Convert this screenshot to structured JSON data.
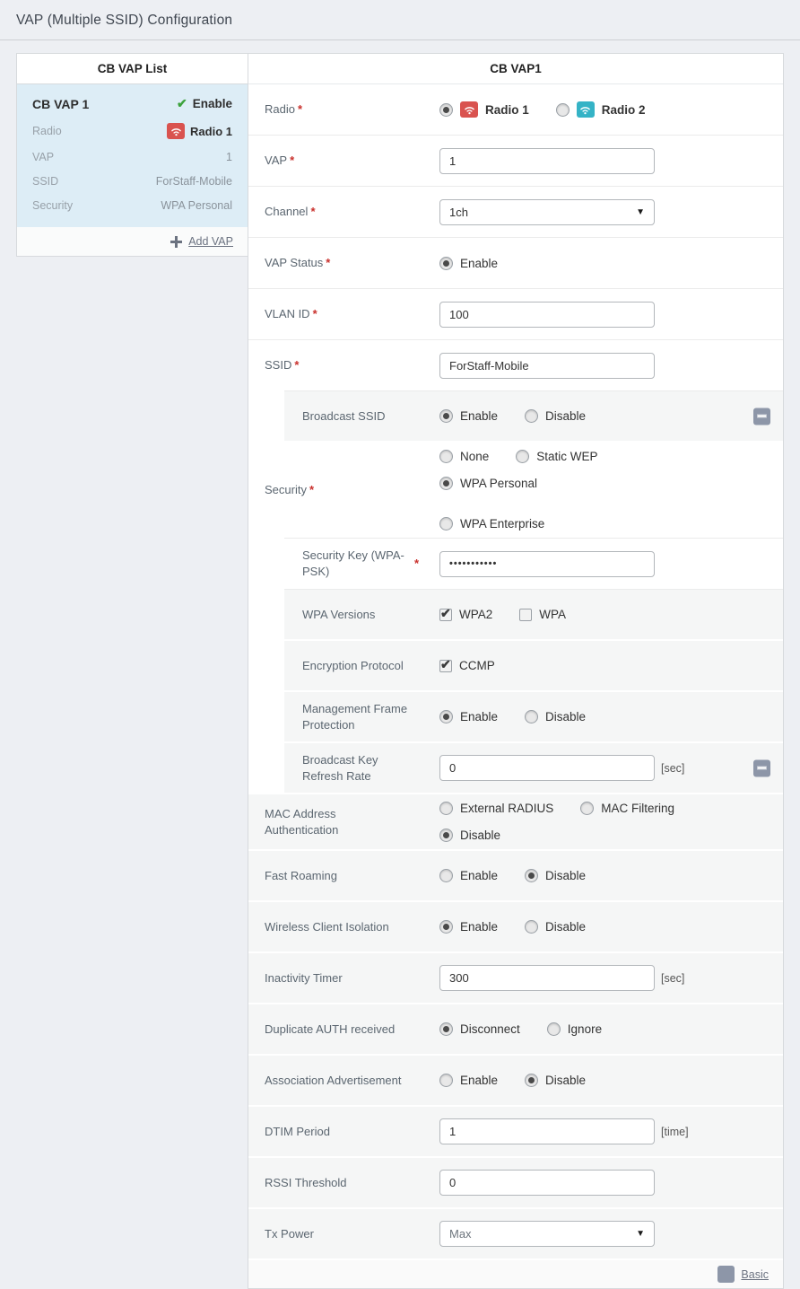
{
  "page": {
    "title": "VAP (Multiple SSID) Configuration"
  },
  "icons": {
    "check": "✔",
    "plus": "➕",
    "caret_down": "▼"
  },
  "colors": {
    "radio1_badge": "#d9534f",
    "radio2_badge": "#35b3c6",
    "enable_check": "#3ca23c",
    "selected_item_bg": "#ddedf6",
    "required_asterisk": "#c9302c",
    "collapse_icon_bg": "#8d96a8"
  },
  "required_marker": "*",
  "vap_list": {
    "header": "CB VAP List",
    "selected_item": {
      "name": "CB VAP 1",
      "status": "Enable",
      "fields": [
        {
          "label": "Radio",
          "value": "Radio 1",
          "badge": "radio1_badge"
        },
        {
          "label": "VAP",
          "value": "1"
        },
        {
          "label": "SSID",
          "value": "ForStaff-Mobile"
        },
        {
          "label": "Security",
          "value": "WPA Personal"
        }
      ]
    },
    "add_link": "Add VAP"
  },
  "form": {
    "header": "CB VAP1",
    "footer": {
      "link": "Basic"
    },
    "rows": [
      {
        "label": "Radio",
        "required": true,
        "control": {
          "type": "radio",
          "options": [
            {
              "label": "Radio 1",
              "selected": true,
              "badge": "radio1_badge",
              "bold": true
            },
            {
              "label": "Radio 2",
              "badge": "radio2_badge",
              "bold": true
            }
          ]
        }
      },
      {
        "label": "VAP",
        "required": true,
        "control": {
          "type": "text",
          "value": "1"
        }
      },
      {
        "label": "Channel",
        "required": true,
        "control": {
          "type": "select",
          "value": "1ch"
        }
      },
      {
        "label": "VAP Status",
        "required": true,
        "control": {
          "type": "radio",
          "options": [
            {
              "label": "Enable",
              "selected": true
            }
          ]
        }
      },
      {
        "label": "VLAN ID",
        "required": true,
        "control": {
          "type": "text",
          "value": "100"
        }
      },
      {
        "label": "SSID",
        "required": true,
        "control": {
          "type": "text",
          "value": "ForStaff-Mobile"
        }
      },
      {
        "label": "Broadcast SSID",
        "indent": true,
        "gray": true,
        "collapse": true,
        "control": {
          "type": "radio",
          "options": [
            {
              "label": "Enable",
              "selected": true
            },
            {
              "label": "Disable"
            }
          ]
        }
      },
      {
        "label": "Security",
        "required": true,
        "tall": true,
        "control": {
          "type": "radio",
          "options": [
            {
              "label": "None"
            },
            {
              "label": "Static WEP"
            },
            {
              "label": "WPA Personal",
              "selected": true
            },
            {
              "label": "WPA Enterprise",
              "break_before": true
            }
          ]
        }
      },
      {
        "label": "Security Key (WPA-PSK)",
        "required": true,
        "indent": true,
        "control": {
          "type": "password",
          "value": "•••••••••••"
        }
      },
      {
        "label": "WPA Versions",
        "indent": true,
        "gray": true,
        "control": {
          "type": "checkbox",
          "options": [
            {
              "label": "WPA2",
              "checked": true
            },
            {
              "label": "WPA"
            }
          ]
        }
      },
      {
        "label": "Encryption Protocol",
        "indent": true,
        "gray": true,
        "control": {
          "type": "checkbox",
          "options": [
            {
              "label": "CCMP",
              "checked": true
            }
          ]
        }
      },
      {
        "label": "Management Frame Protection",
        "indent": true,
        "gray": true,
        "control": {
          "type": "radio",
          "options": [
            {
              "label": "Enable",
              "selected": true
            },
            {
              "label": "Disable"
            }
          ]
        }
      },
      {
        "label": "Broadcast Key Refresh Rate",
        "indent": true,
        "gray": true,
        "collapse": true,
        "unit": "[sec]",
        "control": {
          "type": "text",
          "value": "0"
        }
      },
      {
        "label": "MAC Address Authentication",
        "gray": true,
        "control": {
          "type": "radio",
          "options": [
            {
              "label": "External RADIUS"
            },
            {
              "label": "MAC Filtering"
            },
            {
              "label": "Disable",
              "selected": true
            }
          ]
        }
      },
      {
        "label": "Fast Roaming",
        "gray": true,
        "control": {
          "type": "radio",
          "options": [
            {
              "label": "Enable"
            },
            {
              "label": "Disable",
              "selected": true
            }
          ]
        }
      },
      {
        "label": "Wireless Client Isolation",
        "gray": true,
        "control": {
          "type": "radio",
          "options": [
            {
              "label": "Enable",
              "selected": true
            },
            {
              "label": "Disable"
            }
          ]
        }
      },
      {
        "label": "Inactivity Timer",
        "gray": true,
        "unit": "[sec]",
        "control": {
          "type": "text",
          "value": "300"
        }
      },
      {
        "label": "Duplicate AUTH received",
        "gray": true,
        "control": {
          "type": "radio",
          "options": [
            {
              "label": "Disconnect",
              "selected": true
            },
            {
              "label": "Ignore"
            }
          ]
        }
      },
      {
        "label": "Association Advertisement",
        "gray": true,
        "control": {
          "type": "radio",
          "options": [
            {
              "label": "Enable"
            },
            {
              "label": "Disable",
              "selected": true
            }
          ]
        }
      },
      {
        "label": "DTIM Period",
        "gray": true,
        "unit": "[time]",
        "control": {
          "type": "text",
          "value": "1"
        }
      },
      {
        "label": "RSSI Threshold",
        "gray": true,
        "control": {
          "type": "text",
          "value": "0"
        }
      },
      {
        "label": "Tx Power",
        "gray": true,
        "control": {
          "type": "select",
          "value": "Max",
          "muted": true
        }
      }
    ]
  }
}
